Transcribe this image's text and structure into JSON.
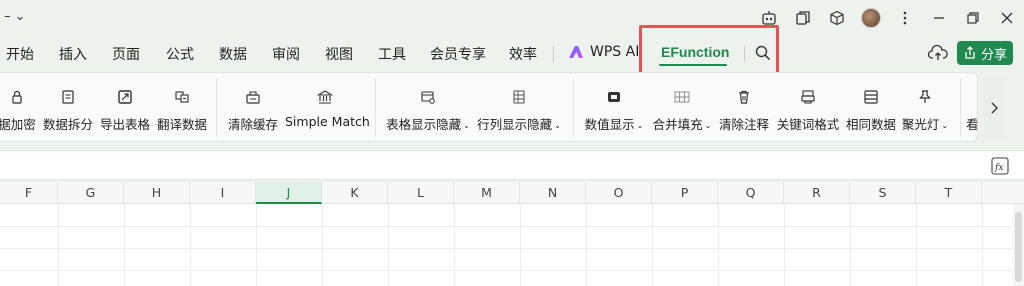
{
  "titlebar": {
    "left_text": "– ⌄"
  },
  "menu": {
    "items": [
      "开始",
      "插入",
      "页面",
      "公式",
      "数据",
      "审阅",
      "视图",
      "工具",
      "会员专享",
      "效率"
    ],
    "wps_ai": "WPS AI",
    "efunction": "EFunction",
    "share": "分享"
  },
  "ribbon": {
    "buttons": [
      {
        "label": "据加密",
        "icon": "lock-icon"
      },
      {
        "label": "数据拆分",
        "icon": "split-icon"
      },
      {
        "label": "导出表格",
        "icon": "export-icon"
      },
      {
        "label": "翻译数据",
        "icon": "translate-icon"
      },
      {
        "label": "清除缓存",
        "icon": "cache-icon"
      },
      {
        "label": "Simple Match",
        "icon": "match-icon"
      },
      {
        "label": "表格显示隐藏",
        "icon": "table-visibility-icon"
      },
      {
        "label": "行列显示隐藏",
        "icon": "rowcol-visibility-icon"
      },
      {
        "label": "数值显示",
        "icon": "number-display-icon"
      },
      {
        "label": "合并填充",
        "icon": "merge-fill-icon"
      },
      {
        "label": "清除注释",
        "icon": "clear-comments-icon"
      },
      {
        "label": "关键词格式",
        "icon": "keyword-format-icon"
      },
      {
        "label": "相同数据",
        "icon": "same-data-icon"
      },
      {
        "label": "聚光灯",
        "icon": "spotlight-icon"
      },
      {
        "label": "看",
        "icon": "more-icon"
      }
    ]
  },
  "grid": {
    "columns": [
      "F",
      "G",
      "H",
      "I",
      "J",
      "K",
      "L",
      "M",
      "N",
      "O",
      "P",
      "Q",
      "R",
      "S",
      "T"
    ],
    "selected_column": "J"
  },
  "colors": {
    "accent": "#1b8a4c",
    "highlight_box": "#e05555"
  }
}
